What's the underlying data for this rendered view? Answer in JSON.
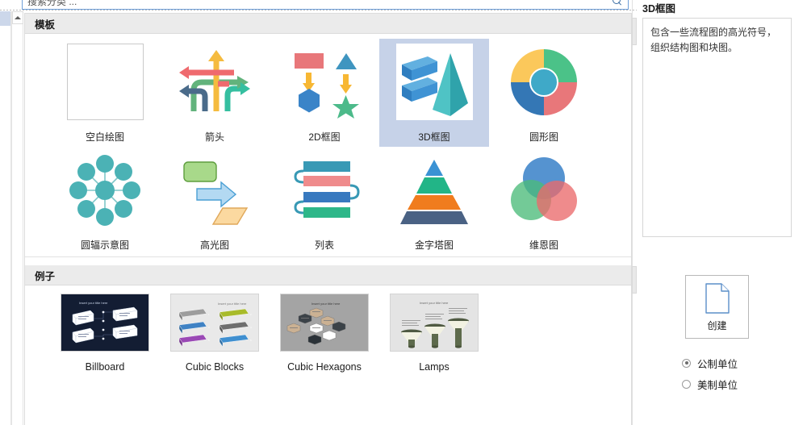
{
  "search": {
    "value": "搜索分类 ...",
    "placeholder": "搜索分类 ...",
    "icon": "search-icon"
  },
  "sections": {
    "templates_header": "模板",
    "examples_header": "例子"
  },
  "templates": {
    "row1": [
      {
        "label": "空白绘图",
        "thumb": "blank-drawing",
        "selected": false
      },
      {
        "label": "箭头",
        "thumb": "arrows",
        "selected": false
      },
      {
        "label": "2D框图",
        "thumb": "block-2d",
        "selected": false
      },
      {
        "label": "3D框图",
        "thumb": "block-3d",
        "selected": true
      },
      {
        "label": "圆形图",
        "thumb": "circular",
        "selected": false
      }
    ],
    "row2": [
      {
        "label": "圆辐示意图",
        "thumb": "radial-spoke",
        "selected": false
      },
      {
        "label": "高光图",
        "thumb": "highlight",
        "selected": false
      },
      {
        "label": "列表",
        "thumb": "list",
        "selected": false
      },
      {
        "label": "金字塔图",
        "thumb": "pyramid",
        "selected": false
      },
      {
        "label": "维恩图",
        "thumb": "venn",
        "selected": false
      }
    ]
  },
  "examples": [
    {
      "label": "Billboard",
      "thumb": "billboard-preview",
      "caption": "Insert your title here"
    },
    {
      "label": "Cubic Blocks",
      "thumb": "cubic-blocks-preview",
      "caption": "Insert your title here"
    },
    {
      "label": "Cubic Hexagons",
      "thumb": "cubic-hexagons-preview",
      "caption": "Insert your title here"
    },
    {
      "label": "Lamps",
      "thumb": "lamps-preview",
      "caption": "Insert your title here"
    }
  ],
  "details": {
    "title": "3D框图",
    "description": "包含一些流程图的高光符号，组织结构图和块图。",
    "create_label": "创建",
    "create_icon": "new-document-icon",
    "units": [
      {
        "label": "公制单位",
        "selected": true
      },
      {
        "label": "美制单位",
        "selected": false
      }
    ]
  },
  "colors": {
    "selection": "#c6d2e8",
    "section_header_bg": "#ebebeb",
    "accent_blue": "#3c6fa5",
    "teal": "#35a0a6",
    "green": "#2bb673",
    "orange": "#f58220",
    "red": "#e8777a",
    "yellow": "#fbc85b"
  },
  "scrollbar": {
    "up_arrow": "caret-up-icon"
  }
}
